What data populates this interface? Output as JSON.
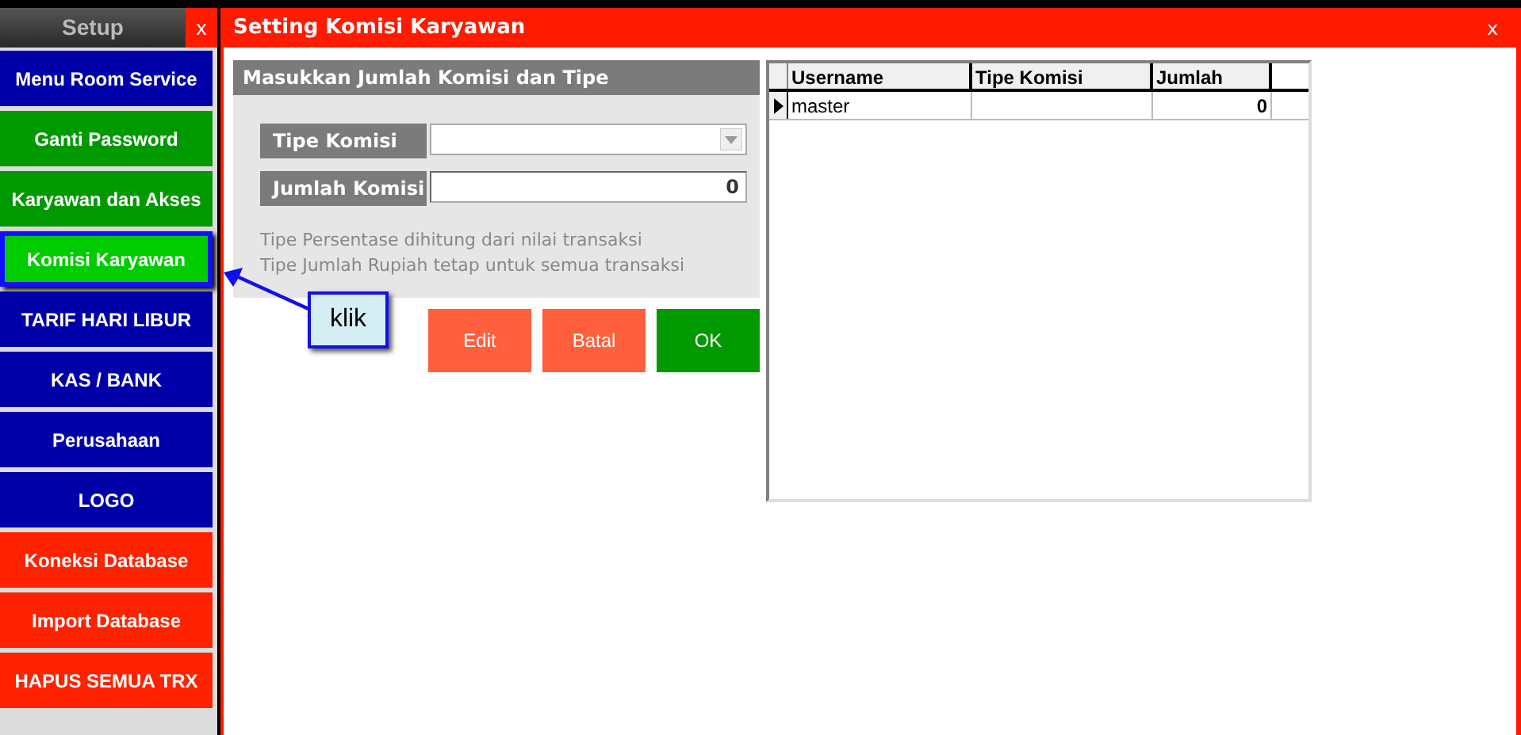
{
  "sidebar": {
    "title": "Setup",
    "close": "x",
    "items": [
      {
        "label": "Menu Room Service",
        "color": "#0000a8",
        "selected": false
      },
      {
        "label": "Ganti Password",
        "color": "#009900",
        "selected": false
      },
      {
        "label": "Karyawan dan Akses",
        "color": "#009900",
        "selected": false
      },
      {
        "label": "Komisi Karyawan",
        "color": "#00cc00",
        "selected": true
      },
      {
        "label": "TARIF HARI LIBUR",
        "color": "#0000a8",
        "selected": false
      },
      {
        "label": "KAS / BANK",
        "color": "#0000a8",
        "selected": false
      },
      {
        "label": "Perusahaan",
        "color": "#0000a8",
        "selected": false
      },
      {
        "label": "LOGO",
        "color": "#0000a8",
        "selected": false
      },
      {
        "label": "Koneksi Database",
        "color": "#ff2200",
        "selected": false
      },
      {
        "label": "Import Database",
        "color": "#ff2200",
        "selected": false
      },
      {
        "label": "HAPUS SEMUA TRX",
        "color": "#ff2200",
        "selected": false
      }
    ]
  },
  "window": {
    "title": "Setting Komisi Karyawan",
    "close": "x"
  },
  "form": {
    "title": "Masukkan Jumlah Komisi dan Tipe",
    "fields": [
      {
        "label": "Tipe Komisi",
        "kind": "dropdown"
      },
      {
        "label": "Jumlah Komisi",
        "kind": "number",
        "value": "0"
      }
    ],
    "notes": [
      "Tipe Persentase dihitung dari nilai transaksi",
      "Tipe Jumlah Rupiah tetap untuk semua transaksi"
    ],
    "buttons": [
      {
        "label": "Edit",
        "color": "#ff5f3c"
      },
      {
        "label": "Batal",
        "color": "#ff5f3c"
      },
      {
        "label": "OK",
        "color": "#009900"
      }
    ]
  },
  "table": {
    "columns": [
      "Username",
      "Tipe Komisi",
      "Jumlah"
    ],
    "rows": [
      {
        "cells": [
          "master",
          "",
          "0"
        ],
        "selected": true
      }
    ]
  },
  "callout": {
    "text": "klik"
  }
}
